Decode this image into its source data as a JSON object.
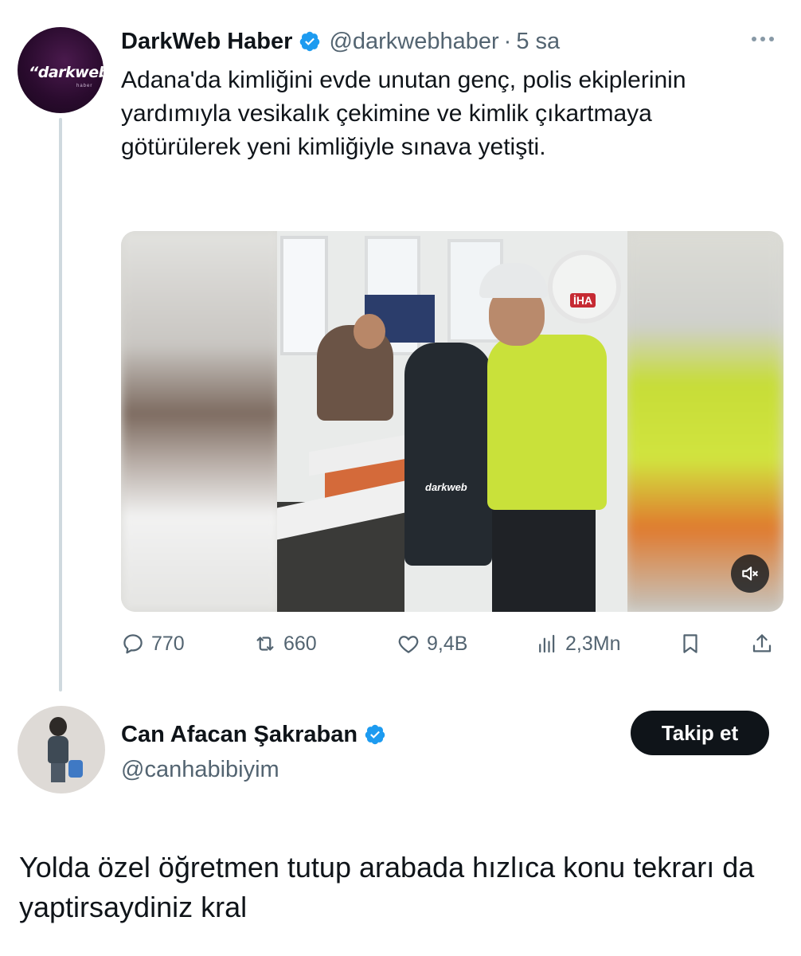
{
  "tweet1": {
    "avatar": {
      "logo_main": "darkweb",
      "logo_sub": "haber"
    },
    "author": {
      "display_name": "DarkWeb Haber",
      "handle": "@darkwebhaber",
      "separator": "·",
      "time": "5 sa"
    },
    "text": "Adana'da kimliğini evde unutan genç, polis ekiplerinin yardımıyla vesikalık çekimine ve kimlik çıkartmaya götürülerek yeni kimliğiyle sınava yetişti.",
    "media": {
      "badge": "İHA",
      "watermark": "darkweb",
      "mute_icon": "volume-muted-icon"
    },
    "stats": {
      "replies": "770",
      "reposts": "660",
      "likes": "9,4B",
      "views": "2,3Mn"
    },
    "colors": {
      "verified": "#1d9bf0",
      "muted_text": "#536471",
      "thread_line": "#cfd9de"
    }
  },
  "tweet2": {
    "author": {
      "display_name": "Can Afacan Şakraban",
      "handle": "@canhabibiyim"
    },
    "follow_label": "Takip et",
    "text": "Yolda özel öğretmen tutup arabada hızlıca konu tekrarı da yaptirsaydiniz kral"
  }
}
